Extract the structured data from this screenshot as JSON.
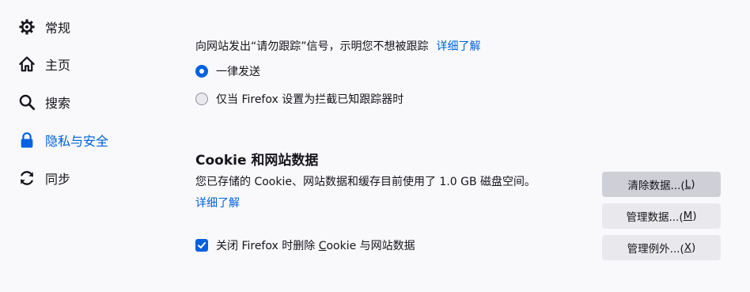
{
  "sidebar": {
    "items": [
      {
        "label": "常规",
        "icon": "gear-icon"
      },
      {
        "label": "主页",
        "icon": "home-icon"
      },
      {
        "label": "搜索",
        "icon": "search-icon"
      },
      {
        "label": "隐私与安全",
        "icon": "lock-icon",
        "active": true
      },
      {
        "label": "同步",
        "icon": "sync-icon"
      }
    ]
  },
  "dnt": {
    "description": "向网站发出“请勿跟踪”信号，示明您不想被跟踪",
    "learn_more": "详细了解",
    "options": [
      {
        "label": "一律发送",
        "selected": true
      },
      {
        "label": "仅当 Firefox 设置为拦截已知跟踪器时",
        "selected": false
      }
    ]
  },
  "cookies": {
    "title": "Cookie 和网站数据",
    "description": "您已存储的 Cookie、网站数据和缓存目前使用了 1.0 GB 磁盘空间。",
    "learn_more": "详细了解",
    "delete_on_close": {
      "label_pre": "关闭 Firefox 时删除 ",
      "label_key": "C",
      "label_post": "ookie 与网站数据",
      "checked": true
    },
    "buttons": {
      "clear": {
        "text": "清除数据...(",
        "key": "L",
        "close": ")"
      },
      "manage": {
        "text": "管理数据...(",
        "key": "M",
        "close": ")"
      },
      "exceptions": {
        "text": "管理例外...(",
        "key": "X",
        "close": ")"
      }
    }
  },
  "colors": {
    "accent": "#0061e0",
    "background": "#f9f9fb",
    "button": "#e9e9ed",
    "button_pressed": "#cfcfd8"
  }
}
